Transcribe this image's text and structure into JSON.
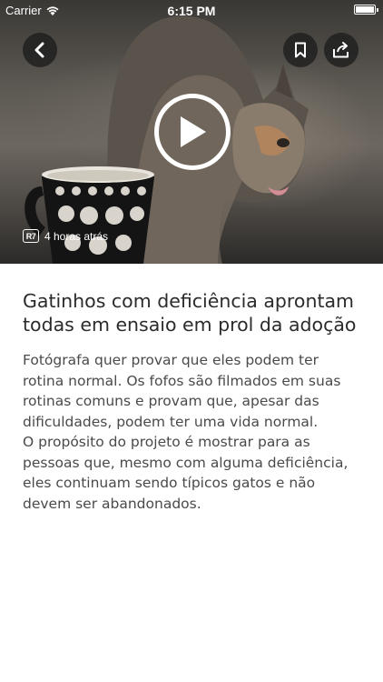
{
  "status_bar": {
    "carrier": "Carrier",
    "time": "6:15 PM"
  },
  "header": {
    "back_icon": "chevron-left-icon",
    "bookmark_icon": "bookmark-icon",
    "share_icon": "share-icon"
  },
  "media": {
    "play_icon": "play-icon",
    "source_logo": "R7",
    "timestamp": "4 horas atrás"
  },
  "article": {
    "title": "Gatinhos com deficiência aprontam todas em ensaio em prol da adoção",
    "paragraph_1": "Fotógrafa quer provar que eles podem ter rotina normal. Os fofos são filmados em suas rotinas comuns e provam que, apesar das dificuldades, podem ter uma vida normal.",
    "paragraph_2": "O propósito do projeto é mostrar para as pessoas que, mesmo com alguma deficiência, eles continuam sendo típicos gatos e não devem ser abandonados."
  },
  "colors": {
    "button_bg": "#1e1e1e",
    "text_title": "#2b2b2b",
    "text_body": "#4a4a4a"
  }
}
